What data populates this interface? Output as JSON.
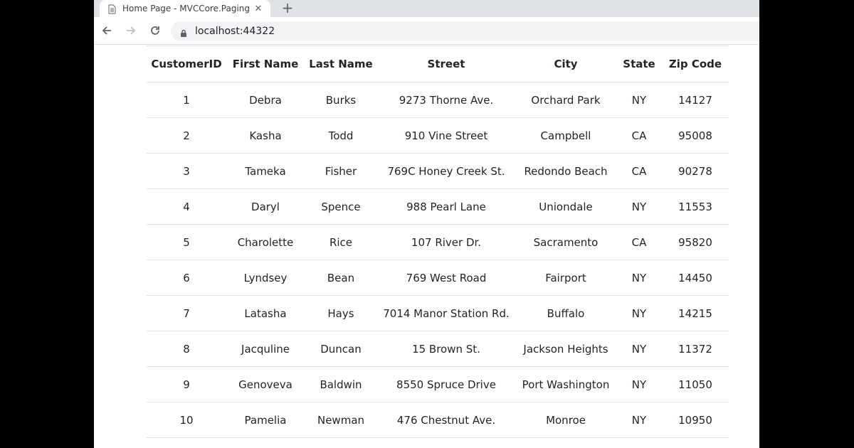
{
  "browser": {
    "tab_title": "Home Page - MVCCore.Paging",
    "tab_close": "✕",
    "new_tab": "+",
    "url": "localhost:44322"
  },
  "table": {
    "headers": [
      "CustomerID",
      "First Name",
      "Last Name",
      "Street",
      "City",
      "State",
      "Zip Code"
    ],
    "rows": [
      [
        "1",
        "Debra",
        "Burks",
        "9273 Thorne Ave.",
        "Orchard Park",
        "NY",
        "14127"
      ],
      [
        "2",
        "Kasha",
        "Todd",
        "910 Vine Street",
        "Campbell",
        "CA",
        "95008"
      ],
      [
        "3",
        "Tameka",
        "Fisher",
        "769C Honey Creek St.",
        "Redondo Beach",
        "CA",
        "90278"
      ],
      [
        "4",
        "Daryl",
        "Spence",
        "988 Pearl Lane",
        "Uniondale",
        "NY",
        "11553"
      ],
      [
        "5",
        "Charolette",
        "Rice",
        "107 River Dr.",
        "Sacramento",
        "CA",
        "95820"
      ],
      [
        "6",
        "Lyndsey",
        "Bean",
        "769 West Road",
        "Fairport",
        "NY",
        "14450"
      ],
      [
        "7",
        "Latasha",
        "Hays",
        "7014 Manor Station Rd.",
        "Buffalo",
        "NY",
        "14215"
      ],
      [
        "8",
        "Jacquline",
        "Duncan",
        "15 Brown St.",
        "Jackson Heights",
        "NY",
        "11372"
      ],
      [
        "9",
        "Genoveva",
        "Baldwin",
        "8550 Spruce Drive",
        "Port Washington",
        "NY",
        "11050"
      ],
      [
        "10",
        "Pamelia",
        "Newman",
        "476 Chestnut Ave.",
        "Monroe",
        "NY",
        "10950"
      ]
    ]
  }
}
